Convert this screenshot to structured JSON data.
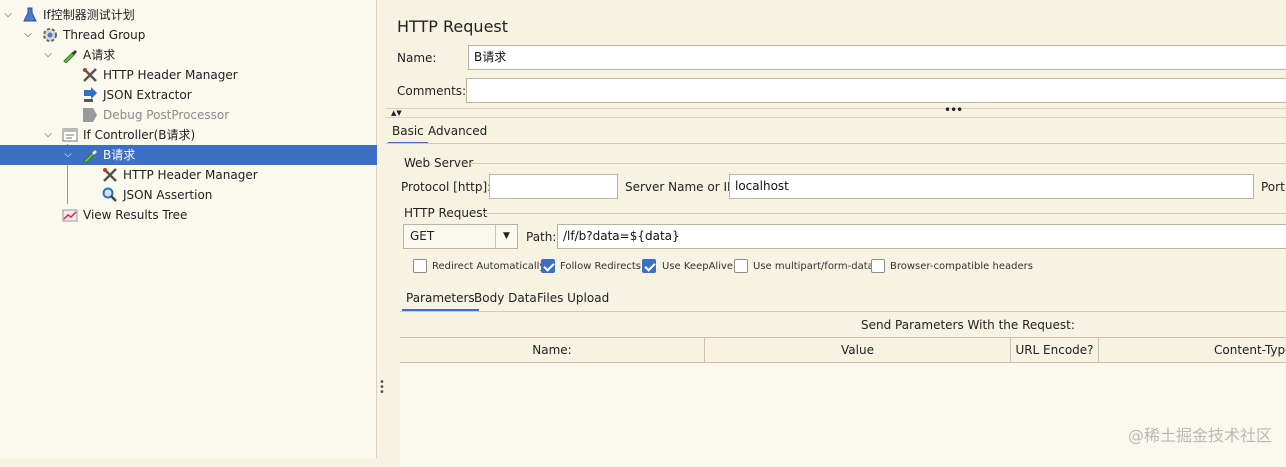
{
  "tree": {
    "items": [
      {
        "label": "If控制器测试计划",
        "icon": "test-plan-icon",
        "level": 0,
        "expanded": true
      },
      {
        "label": "Thread Group",
        "icon": "thread-group-gear-icon",
        "level": 1,
        "expanded": true
      },
      {
        "label": "A请求",
        "icon": "http-request-pipette-icon",
        "level": 2,
        "expanded": true
      },
      {
        "label": "HTTP Header Manager",
        "icon": "tools-icon",
        "level": 3
      },
      {
        "label": "JSON Extractor",
        "icon": "extractor-arrow-icon",
        "level": 3
      },
      {
        "label": "Debug PostProcessor",
        "icon": "debug-postprocessor-icon",
        "level": 3,
        "disabled": true
      },
      {
        "label": "If Controller(B请求)",
        "icon": "if-controller-icon",
        "level": 2,
        "expanded": true
      },
      {
        "label": "B请求",
        "icon": "http-request-pipette-icon",
        "level": 3,
        "expanded": true,
        "selected": true
      },
      {
        "label": "HTTP Header Manager",
        "icon": "tools-icon",
        "level": 4
      },
      {
        "label": "JSON Assertion",
        "icon": "magnifier-icon",
        "level": 4
      },
      {
        "label": "View Results Tree",
        "icon": "results-tree-chart-icon",
        "level": 2
      }
    ]
  },
  "panel": {
    "title": "HTTP Request",
    "name_label": "Name:",
    "name_value": "B请求",
    "comments_label": "Comments:",
    "comments_value": ""
  },
  "tabs": {
    "basic": "Basic",
    "advanced": "Advanced"
  },
  "web_server": {
    "legend": "Web Server",
    "protocol_label": "Protocol [http]:",
    "protocol_value": "",
    "server_label": "Server Name or IP:",
    "server_value": "localhost",
    "port_label": "Port"
  },
  "http_request": {
    "legend": "HTTP Request",
    "method": "GET",
    "path_label": "Path:",
    "path_value": "/lf/b?data=${data}"
  },
  "options": [
    {
      "label": "Redirect Automatically",
      "checked": false
    },
    {
      "label": "Follow Redirects",
      "checked": true
    },
    {
      "label": "Use KeepAlive",
      "checked": true
    },
    {
      "label": "Use multipart/form-data",
      "checked": false
    },
    {
      "label": "Browser-compatible headers",
      "checked": false
    }
  ],
  "param_tabs": {
    "parameters": "Parameters",
    "body_data": "Body Data",
    "files_upload": "Files Upload"
  },
  "params_table": {
    "caption": "Send Parameters With the Request:",
    "columns": [
      "Name:",
      "Value",
      "URL Encode?",
      "Content-Type"
    ]
  },
  "watermark": "@稀土掘金技术社区",
  "colors": {
    "selection": "#3d6fc4",
    "background": "#f7f2e2"
  }
}
